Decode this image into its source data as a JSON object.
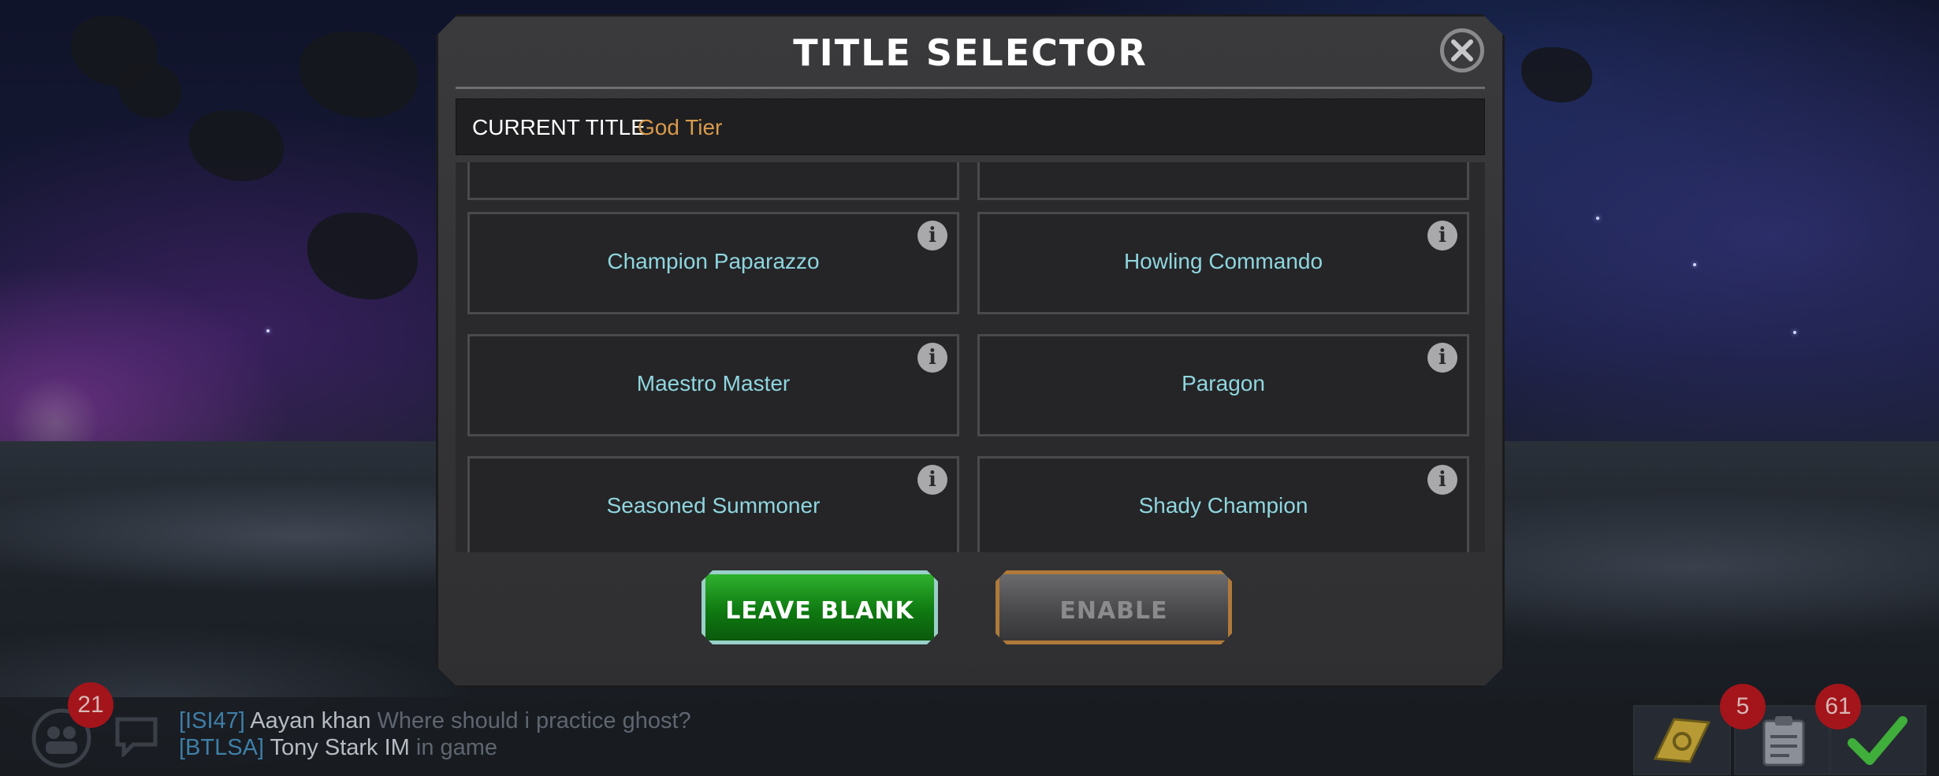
{
  "modal": {
    "title": "TITLE SELECTOR",
    "current_title_label": "CURRENT TITLE",
    "current_title_value": "God Tier",
    "titles": [
      "Champion Paparazzo",
      "Howling Commando",
      "Maestro Master",
      "Paragon",
      "Seasoned Summoner",
      "Shady Champion"
    ],
    "info_glyph": "i",
    "leave_blank_label": "LEAVE BLANK",
    "enable_label": "ENABLE"
  },
  "chat": {
    "unread_count": "21",
    "messages": [
      {
        "tag": "[ISI47]",
        "name": "Aayan khan",
        "text": "Where should i practice ghost?"
      },
      {
        "tag": "[BTLSA]",
        "name": "Tony Stark IM",
        "text": "in game"
      }
    ],
    "notifications": {
      "tasks": "5",
      "quests": "61"
    }
  },
  "colors": {
    "title_text": "#8fd6df",
    "current_value": "#d99a4c",
    "leave_blank_green": "#0f7a11",
    "badge_red": "#a3151a"
  }
}
